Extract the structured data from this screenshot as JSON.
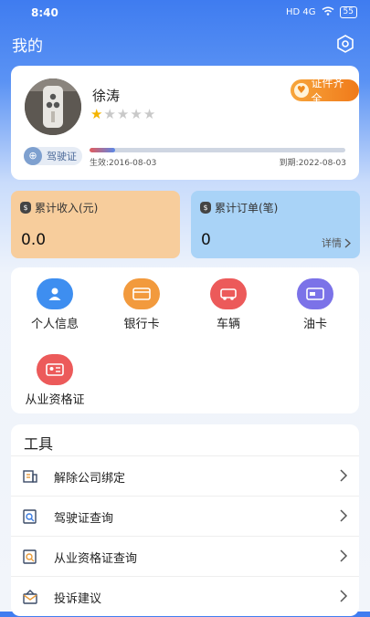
{
  "status": {
    "time": "8:40",
    "network": "HD 4G",
    "battery": "55"
  },
  "header": {
    "title": "我的"
  },
  "profile": {
    "name": "徐涛",
    "rating": 1,
    "rating_max": 5,
    "cert_badge": "证件齐全",
    "license_label": "驾驶证",
    "license_progress": 0.1,
    "valid_from": "生效:2016-08-03",
    "valid_to": "到期:2022-08-03"
  },
  "stats": [
    {
      "label": "累计收入(元)",
      "value": "0.0"
    },
    {
      "label": "累计订单(笔)",
      "value": "0",
      "link": "详情"
    }
  ],
  "grid_items": [
    {
      "label": "个人信息",
      "icon": "person-icon",
      "color": "#3e8ef0"
    },
    {
      "label": "银行卡",
      "icon": "bank-card-icon",
      "color": "#f29a3d"
    },
    {
      "label": "车辆",
      "icon": "vehicle-icon",
      "color": "#ec5a5a"
    },
    {
      "label": "油卡",
      "icon": "fuel-card-icon",
      "color": "#7b72e8"
    },
    {
      "label": "从业资格证",
      "icon": "qualification-icon",
      "color": "#ec5a5a"
    }
  ],
  "tools": {
    "title": "工具",
    "items": [
      {
        "label": "解除公司绑定",
        "icon": "unbind-company-icon"
      },
      {
        "label": "驾驶证查询",
        "icon": "license-search-icon"
      },
      {
        "label": "从业资格证查询",
        "icon": "qualification-search-icon"
      },
      {
        "label": "投诉建议",
        "icon": "feedback-icon"
      }
    ]
  }
}
